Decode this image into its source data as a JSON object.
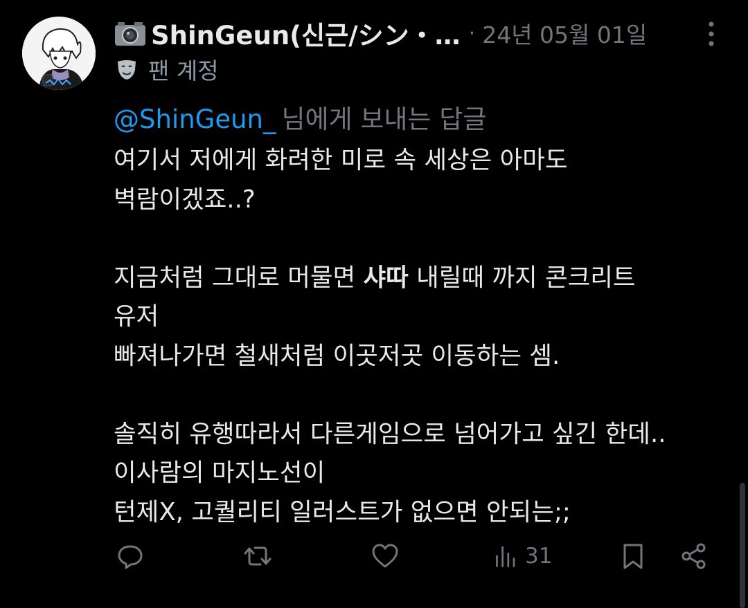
{
  "author": {
    "display_name": "ShinGeun(신근/シン・…",
    "badge": "팬 계정",
    "avatar_icon": "anime-character-avatar",
    "name_prefix_icon": "camera-icon",
    "badge_icon": "mask-icon"
  },
  "meta": {
    "separator": "·",
    "timestamp": "24년 05월 01일"
  },
  "reply": {
    "mention": "@ShinGeun_",
    "suffix": "님에게 보내는 답글"
  },
  "tweet": {
    "lines": [
      "여기서 저에게 화려한 미로 속 세상은 아마도",
      "벽람이겠죠..?",
      "",
      "지금처럼 그대로 머물면 ",
      "유저",
      "빠져나가면 철새처럼 이곳저곳 이동하는 셈.",
      "",
      "솔직히 유행따라서 다른게임으로 넘어가고 싶긴 한데..",
      "이사람의 마지노선이",
      "턴제X, 고퀄리티 일러스트가 없으면 안되는;;"
    ],
    "line4_bold": "샤따",
    "line4_rest": " 내릴때 까지 콘크리트"
  },
  "actions": {
    "reply_icon": "reply-icon",
    "retweet_icon": "retweet-icon",
    "like_icon": "heart-icon",
    "views_icon": "views-icon",
    "views_count": "31",
    "bookmark_icon": "bookmark-icon",
    "share_icon": "share-icon"
  },
  "colors": {
    "background": "#000000",
    "text": "#e7e9ea",
    "secondary": "#71767b",
    "link": "#1d9bf0"
  }
}
